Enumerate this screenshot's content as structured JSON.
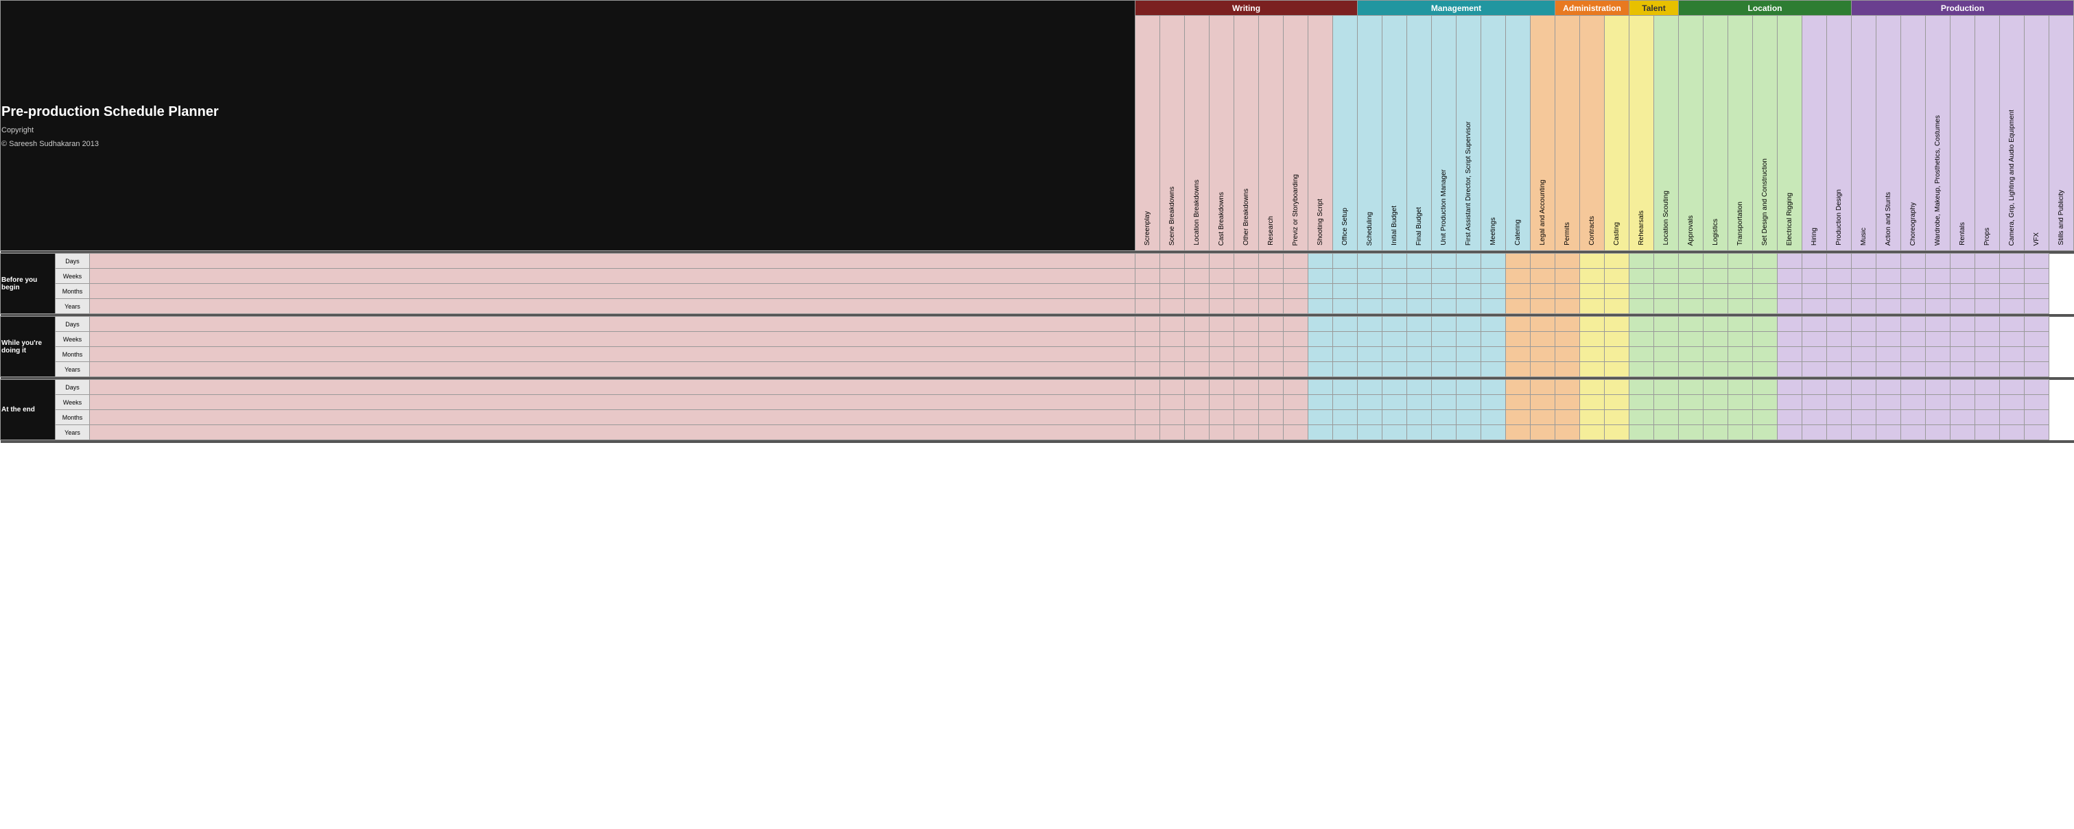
{
  "title": {
    "main": "Pre-production Schedule Planner",
    "copyright": "Copyright",
    "author": "© Sareesh    Sudhakaran 2013"
  },
  "categories": [
    {
      "id": "writing",
      "label": "Writing",
      "class": "cat-writing",
      "colspan": 9
    },
    {
      "id": "management",
      "label": "Management",
      "class": "cat-management",
      "colspan": 8
    },
    {
      "id": "administration",
      "label": "Administration",
      "class": "cat-administration",
      "colspan": 3
    },
    {
      "id": "talent",
      "label": "Talent",
      "class": "cat-talent",
      "colspan": 2
    },
    {
      "id": "location",
      "label": "Location",
      "class": "cat-location",
      "colspan": 7
    },
    {
      "id": "production",
      "label": "Production",
      "class": "cat-production",
      "colspan": 14
    }
  ],
  "columns": [
    {
      "id": "screenplay",
      "label": "Screenplay",
      "cat": "writing",
      "class": "col-writing"
    },
    {
      "id": "scene-breakdowns",
      "label": "Scene Breakdowns",
      "cat": "writing",
      "class": "col-writing"
    },
    {
      "id": "location-breakdowns",
      "label": "Location Breakdowns",
      "cat": "writing",
      "class": "col-writing"
    },
    {
      "id": "cast-breakdowns",
      "label": "Cast Breakdowns",
      "cat": "writing",
      "class": "col-writing"
    },
    {
      "id": "other-breakdowns",
      "label": "Other Breakdowns",
      "cat": "writing",
      "class": "col-writing"
    },
    {
      "id": "research",
      "label": "Research",
      "cat": "writing",
      "class": "col-writing"
    },
    {
      "id": "previz",
      "label": "Previz or Storyboarding",
      "cat": "writing",
      "class": "col-writing"
    },
    {
      "id": "shooting-script",
      "label": "Shooting Script",
      "cat": "writing",
      "class": "col-writing"
    },
    {
      "id": "office-setup",
      "label": "Office Setup",
      "cat": "management",
      "class": "col-management"
    },
    {
      "id": "scheduling",
      "label": "Scheduling",
      "cat": "management",
      "class": "col-management"
    },
    {
      "id": "initial-budget",
      "label": "Initial Budget",
      "cat": "management",
      "class": "col-management"
    },
    {
      "id": "final-budget",
      "label": "Final Budget",
      "cat": "management",
      "class": "col-management"
    },
    {
      "id": "unit-production-manager",
      "label": "Unit Production Manager",
      "cat": "management",
      "class": "col-management"
    },
    {
      "id": "first-ad",
      "label": "First Assistant Director, Script Supervisor",
      "cat": "management",
      "class": "col-management"
    },
    {
      "id": "meetings",
      "label": "Meetings",
      "cat": "management",
      "class": "col-management"
    },
    {
      "id": "catering",
      "label": "Catering",
      "cat": "management",
      "class": "col-management"
    },
    {
      "id": "legal-accounting",
      "label": "Legal and Accounting",
      "cat": "administration",
      "class": "col-administration"
    },
    {
      "id": "permits",
      "label": "Permits",
      "cat": "administration",
      "class": "col-administration"
    },
    {
      "id": "contracts",
      "label": "Contracts",
      "cat": "administration",
      "class": "col-administration"
    },
    {
      "id": "casting",
      "label": "Casting",
      "cat": "talent",
      "class": "col-talent"
    },
    {
      "id": "rehearsals",
      "label": "Rehearsals",
      "cat": "talent",
      "class": "col-talent"
    },
    {
      "id": "location-scouting",
      "label": "Location Scouting",
      "cat": "location",
      "class": "col-location"
    },
    {
      "id": "approvals",
      "label": "Approvals",
      "cat": "location",
      "class": "col-location"
    },
    {
      "id": "logistics",
      "label": "Logistics",
      "cat": "location",
      "class": "col-location"
    },
    {
      "id": "transportation",
      "label": "Transportation",
      "cat": "location",
      "class": "col-location"
    },
    {
      "id": "set-design",
      "label": "Set Design and Construction",
      "cat": "location",
      "class": "col-location"
    },
    {
      "id": "electrical-rigging",
      "label": "Electrical Rigging",
      "cat": "location",
      "class": "col-location"
    },
    {
      "id": "hiring",
      "label": "Hiring",
      "cat": "production",
      "class": "col-production"
    },
    {
      "id": "production-design",
      "label": "Production Design",
      "cat": "production",
      "class": "col-production"
    },
    {
      "id": "music",
      "label": "Music",
      "cat": "production",
      "class": "col-production"
    },
    {
      "id": "action-stunts",
      "label": "Action and Stunts",
      "cat": "production",
      "class": "col-production"
    },
    {
      "id": "choreography",
      "label": "Choreography",
      "cat": "production",
      "class": "col-production"
    },
    {
      "id": "wardrobe",
      "label": "Wardrobe, Makeup, Prosthetics, Costumes",
      "cat": "production",
      "class": "col-production"
    },
    {
      "id": "rentals",
      "label": "Rentals",
      "cat": "production",
      "class": "col-production"
    },
    {
      "id": "props",
      "label": "Props",
      "cat": "production",
      "class": "col-production"
    },
    {
      "id": "camera-grip",
      "label": "Camera, Grip, Lighting and Audio Equipment",
      "cat": "production",
      "class": "col-production"
    },
    {
      "id": "vfx",
      "label": "VFX",
      "cat": "production",
      "class": "col-production"
    },
    {
      "id": "stills-publicity",
      "label": "Stills and Publicity",
      "cat": "production",
      "class": "col-production"
    }
  ],
  "rowGroups": [
    {
      "id": "before-you-begin",
      "label": "Before you begin",
      "periods": [
        "Days",
        "Weeks",
        "Months",
        "Years"
      ]
    },
    {
      "id": "while-doing-it",
      "label": "While you're doing it",
      "periods": [
        "Days",
        "Weeks",
        "Months",
        "Years"
      ]
    },
    {
      "id": "at-the-end",
      "label": "At the end",
      "periods": [
        "Days",
        "Weeks",
        "Months",
        "Years"
      ]
    }
  ]
}
